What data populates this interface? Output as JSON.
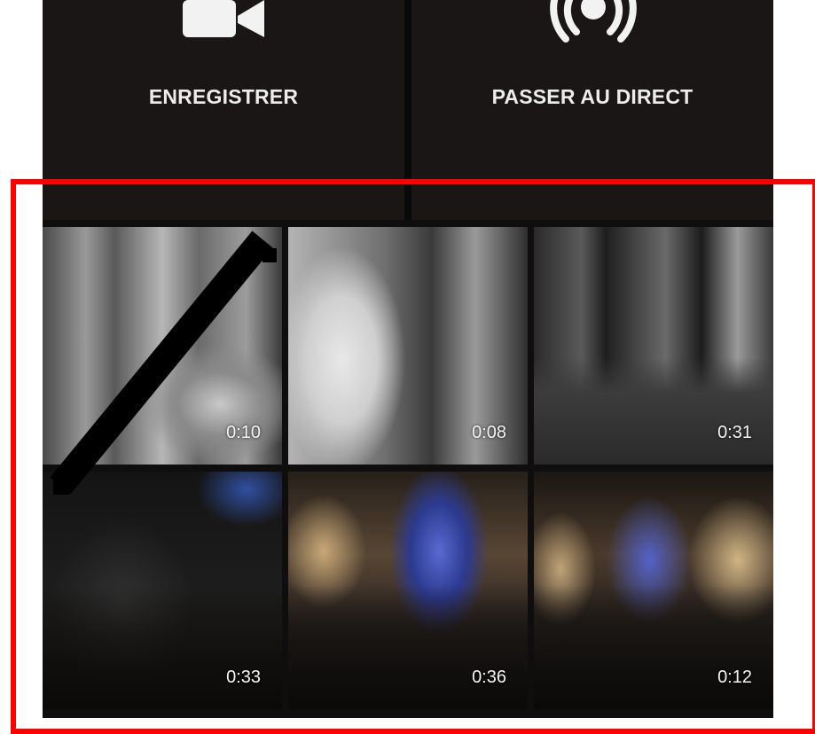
{
  "actions": {
    "record": {
      "label": "ENREGISTRER",
      "icon": "video-camera-icon"
    },
    "live": {
      "label": "PASSER AU DIRECT",
      "icon": "broadcast-icon"
    }
  },
  "gallery": {
    "videos": [
      {
        "duration": "0:10"
      },
      {
        "duration": "0:08"
      },
      {
        "duration": "0:31"
      },
      {
        "duration": "0:33"
      },
      {
        "duration": "0:36"
      },
      {
        "duration": "0:12"
      }
    ]
  },
  "colors": {
    "panel": "#0f0d0d",
    "highlight": "#ff0000",
    "label": "#ececec"
  }
}
